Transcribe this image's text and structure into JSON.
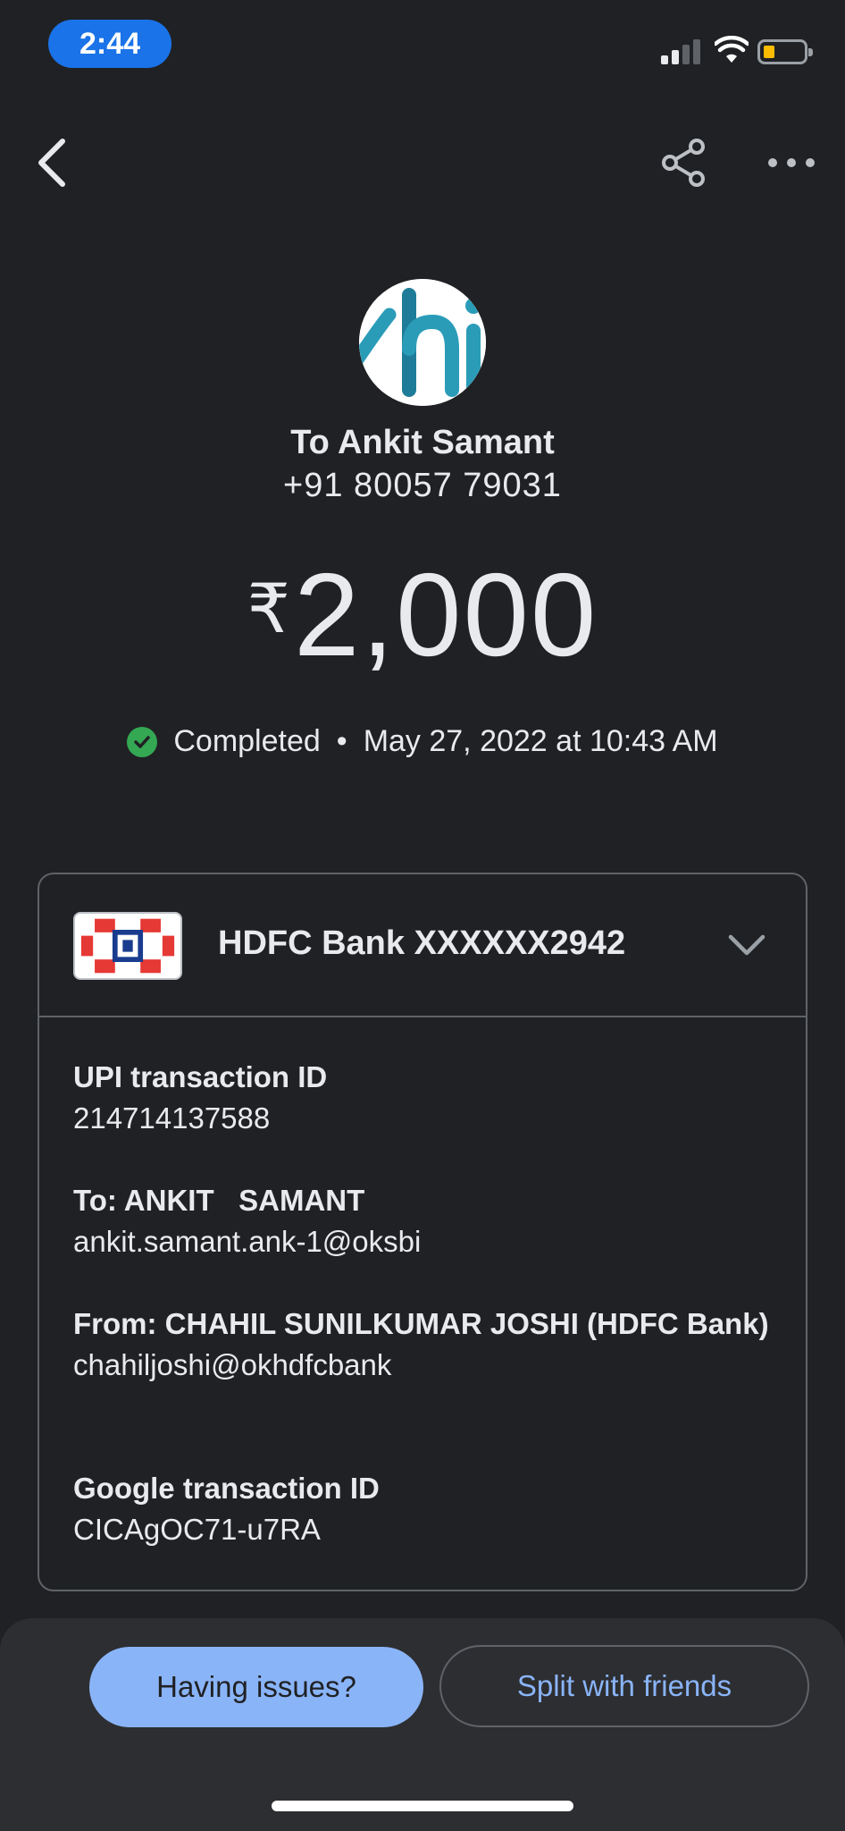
{
  "status_bar": {
    "time": "2:44"
  },
  "header": {
    "back_icon": "chevron-left-icon",
    "share_icon": "share-icon",
    "more_icon": "more-horizontal-icon"
  },
  "recipient": {
    "to_label": "To Ankit Samant",
    "phone": "+91 80057 79031"
  },
  "amount": {
    "currency": "₹",
    "value": "2,000"
  },
  "status": {
    "state": "Completed",
    "separator": "•",
    "timestamp": "May 27, 2022 at 10:43 AM",
    "color": "#34a853"
  },
  "bank": {
    "name": "HDFC Bank XXXXXX2942"
  },
  "details": [
    {
      "label": "UPI transaction ID",
      "value": "214714137588"
    },
    {
      "label": "To: ANKIT   SAMANT",
      "value": "ankit.samant.ank-1@oksbi"
    },
    {
      "label": "From: CHAHIL SUNILKUMAR JOSHI (HDFC Bank)",
      "value": "chahiljoshi@okhdfcbank"
    },
    {
      "label": "Google transaction ID",
      "value": "CICAgOC71-u7RA"
    }
  ],
  "actions": {
    "issues_label": "Having issues?",
    "split_label": "Split with friends"
  },
  "colors": {
    "background": "#202124",
    "accent": "#8ab4f8",
    "time_pill": "#1a73e8"
  }
}
